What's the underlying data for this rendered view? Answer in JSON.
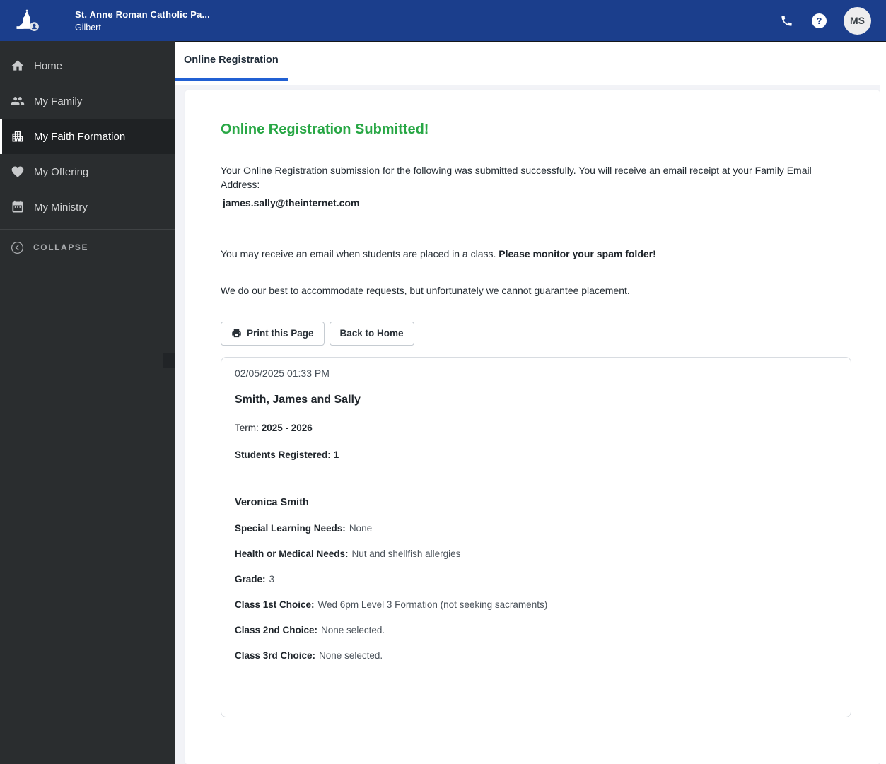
{
  "header": {
    "org_name": "St. Anne Roman Catholic Pa...",
    "org_location": "Gilbert",
    "avatar_initials": "MS",
    "help_glyph": "?",
    "icons": [
      "church-logo-icon",
      "phone-icon",
      "help-icon"
    ]
  },
  "sidebar": {
    "items": [
      {
        "label": "Home",
        "icon": "home-icon",
        "active": false
      },
      {
        "label": "My Family",
        "icon": "family-icon",
        "active": false
      },
      {
        "label": "My Faith Formation",
        "icon": "faith-formation-building-icon",
        "active": true
      },
      {
        "label": "My Offering",
        "icon": "heart-icon",
        "active": false
      },
      {
        "label": "My Ministry",
        "icon": "calendar-icon",
        "active": false
      }
    ],
    "collapse_label": "COLLAPSE",
    "collapse_icon": "chevron-left-circle-icon"
  },
  "tabs": [
    {
      "label": "Online Registration",
      "active": true
    }
  ],
  "main": {
    "title": "Online Registration Submitted!",
    "intro": "Your Online Registration submission for the following was submitted successfully. You will receive an email receipt at your Family Email Address:",
    "family_email": "james.sally@theinternet.com",
    "note_plain": "You may receive an email when students are placed in a class. ",
    "note_bold": "Please monitor your spam folder!",
    "disclaimer": "We do our best to accommodate requests, but unfortunately we cannot guarantee placement.",
    "buttons": {
      "print_label": "Print this Page",
      "print_icon": "printer-icon",
      "back_label": "Back to Home"
    }
  },
  "receipt": {
    "timestamp": "02/05/2025 01:33 PM",
    "family_name": "Smith, James and Sally",
    "term_label": "Term:",
    "term_value": "2025 - 2026",
    "students_label": "Students Registered:",
    "students_value": "1",
    "student": {
      "name": "Veronica Smith",
      "fields": [
        {
          "label": "Special Learning Needs:",
          "value": "None"
        },
        {
          "label": "Health or Medical Needs:",
          "value": "Nut and shellfish allergies"
        },
        {
          "label": "Grade:",
          "value": "3"
        },
        {
          "label": "Class 1st Choice:",
          "value": "Wed 6pm Level 3 Formation (not seeking sacraments)"
        },
        {
          "label": "Class 2nd Choice:",
          "value": "None selected."
        },
        {
          "label": "Class 3rd Choice:",
          "value": "None selected."
        }
      ]
    }
  },
  "colors": {
    "header_bar": "#1b3e8c",
    "sidebar_bg": "#2a2d2f",
    "sidebar_active_bg": "#1f2224",
    "tab_underline": "#2160d3",
    "success_green": "#28a745",
    "content_bg": "#f2f3f7"
  }
}
